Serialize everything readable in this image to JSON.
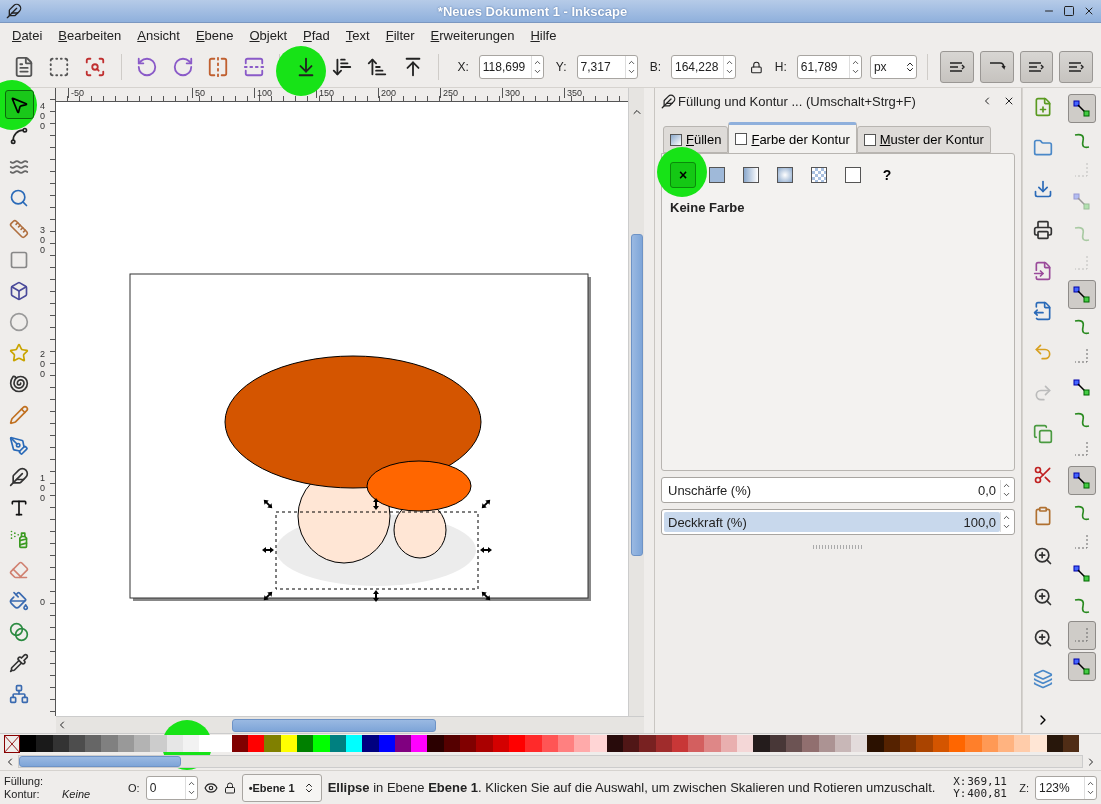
{
  "window": {
    "title": "*Neues Dokument 1 - Inkscape"
  },
  "menu": [
    "Datei",
    "Bearbeiten",
    "Ansicht",
    "Ebene",
    "Objekt",
    "Pfad",
    "Text",
    "Filter",
    "Erweiterungen",
    "Hilfe"
  ],
  "toolbar": {
    "fields": [
      {
        "label": "X:",
        "value": "118,699"
      },
      {
        "label": "Y:",
        "value": "7,317"
      },
      {
        "label": "B:",
        "value": "164,228"
      },
      {
        "label": "H:",
        "value": "61,789"
      }
    ],
    "unit": "px",
    "toggles": [
      {
        "on": true
      },
      {
        "on": true
      },
      {
        "on": true
      },
      {
        "on": true
      }
    ]
  },
  "tools": [
    {
      "selected": true
    },
    {
      "selected": false
    },
    {
      "selected": false
    },
    {
      "selected": false
    },
    {
      "selected": false
    },
    {
      "selected": false
    },
    {
      "selected": false
    },
    {
      "selected": false
    },
    {
      "selected": false
    },
    {
      "selected": false
    },
    {
      "selected": false
    },
    {
      "selected": false
    },
    {
      "selected": false
    },
    {
      "selected": false
    },
    {
      "selected": false
    },
    {
      "selected": false
    },
    {
      "selected": false
    },
    {
      "selected": false
    },
    {
      "selected": false
    },
    {
      "selected": false
    }
  ],
  "ruler": {
    "horizontal": [
      "-50",
      "50",
      "100",
      "150",
      "200",
      "250",
      "300",
      "350"
    ],
    "vertical": [
      "400",
      "300",
      "200",
      "100",
      "0"
    ]
  },
  "panel": {
    "title": "Füllung und Kontur ... (Umschalt+Strg+F)",
    "tabs": [
      {
        "label": "Füllen",
        "selected": false
      },
      {
        "label": "Farbe der Kontur",
        "selected": true
      },
      {
        "label": "Muster der Kontur",
        "selected": false
      }
    ],
    "paint_types": [
      {
        "kind": "none",
        "label": "×",
        "selected": true
      },
      {
        "kind": "flat",
        "selected": false
      },
      {
        "kind": "linear",
        "selected": false
      },
      {
        "kind": "radial",
        "selected": false
      },
      {
        "kind": "pattern",
        "selected": false
      },
      {
        "kind": "swatch",
        "selected": false
      },
      {
        "kind": "unset",
        "label": "?",
        "selected": false
      }
    ],
    "paint_label": "Keine Farbe",
    "sliders": [
      {
        "label": "Unschärfe (%)",
        "value": "0,0",
        "level": 0
      },
      {
        "label": "Deckkraft (%)",
        "value": "100,0",
        "level": 1
      }
    ]
  },
  "snap_bar": [
    {
      "on": true,
      "disabled": false
    },
    {
      "on": false,
      "disabled": false
    },
    {
      "on": false,
      "disabled": true
    },
    {
      "on": false,
      "disabled": true
    },
    {
      "on": false,
      "disabled": true
    },
    {
      "on": false,
      "disabled": true
    },
    {
      "on": true,
      "disabled": false
    },
    {
      "on": false,
      "disabled": false
    },
    {
      "on": false,
      "disabled": false
    },
    {
      "on": false,
      "disabled": false
    },
    {
      "on": false,
      "disabled": false
    },
    {
      "on": false,
      "disabled": false
    },
    {
      "on": true,
      "disabled": false
    },
    {
      "on": false,
      "disabled": false
    },
    {
      "on": false,
      "disabled": false
    },
    {
      "on": false,
      "disabled": false
    },
    {
      "on": false,
      "disabled": false
    },
    {
      "on": true,
      "disabled": false
    },
    {
      "on": true,
      "disabled": false
    }
  ],
  "palette": [
    {
      "color": "#000000"
    },
    {
      "color": "#1a1a1a"
    },
    {
      "color": "#333333"
    },
    {
      "color": "#4d4d4d"
    },
    {
      "color": "#666666"
    },
    {
      "color": "#808080"
    },
    {
      "color": "#999999"
    },
    {
      "color": "#b3b3b3"
    },
    {
      "color": "#cccccc"
    },
    {
      "color": "#e6e6e6"
    },
    {
      "color": "#f2f2f2"
    },
    {
      "color": "#ffffff"
    },
    {
      "color": "#ffffff"
    },
    {
      "color": "#800000"
    },
    {
      "color": "#ff0000"
    },
    {
      "color": "#808000"
    },
    {
      "color": "#ffff00"
    },
    {
      "color": "#008000"
    },
    {
      "color": "#00ff00"
    },
    {
      "color": "#008080"
    },
    {
      "color": "#00ffff"
    },
    {
      "color": "#000080"
    },
    {
      "color": "#0000ff"
    },
    {
      "color": "#800080"
    },
    {
      "color": "#ff00ff"
    },
    {
      "color": "#2b0000"
    },
    {
      "color": "#550000"
    },
    {
      "color": "#800000"
    },
    {
      "color": "#aa0000"
    },
    {
      "color": "#d40000"
    },
    {
      "color": "#ff0000"
    },
    {
      "color": "#ff2a2a"
    },
    {
      "color": "#ff5555"
    },
    {
      "color": "#ff8080"
    },
    {
      "color": "#ffaaaa"
    },
    {
      "color": "#ffd5d5"
    },
    {
      "color": "#280b0b"
    },
    {
      "color": "#501616"
    },
    {
      "color": "#782121"
    },
    {
      "color": "#a02c2c"
    },
    {
      "color": "#c83737"
    },
    {
      "color": "#d35f5f"
    },
    {
      "color": "#de8787"
    },
    {
      "color": "#e9afaf"
    },
    {
      "color": "#f4d7d7"
    },
    {
      "color": "#241c1c"
    },
    {
      "color": "#483737"
    },
    {
      "color": "#6c5353"
    },
    {
      "color": "#916f6f"
    },
    {
      "color": "#ac9393"
    },
    {
      "color": "#c8b7b7"
    },
    {
      "color": "#e3dbdb"
    },
    {
      "color": "#2b1100"
    },
    {
      "color": "#552200"
    },
    {
      "color": "#803300"
    },
    {
      "color": "#aa4400"
    },
    {
      "color": "#d45500"
    },
    {
      "color": "#ff6600"
    },
    {
      "color": "#ff7f2a"
    },
    {
      "color": "#ff9955"
    },
    {
      "color": "#ffb380"
    },
    {
      "color": "#ffccaa"
    },
    {
      "color": "#ffe6d5"
    },
    {
      "color": "#28170b"
    },
    {
      "color": "#502d16"
    }
  ],
  "status": {
    "fill_label": "Füllung:",
    "stroke_label": "Kontur:",
    "stroke_value": "Keine",
    "opacity_label": "O:",
    "opacity_value": "0",
    "layer": "•Ebene 1",
    "message": "**Ellipse** in Ebene **Ebene 1**. Klicken Sie auf die Auswahl, um zwischen Skalieren und Rotieren umzuschalt.",
    "x_label": "X:",
    "x_value": "369,11",
    "y_label": "Y:",
    "y_value": "400,81",
    "zoom_label": "Z:",
    "zoom_value": "123%"
  }
}
